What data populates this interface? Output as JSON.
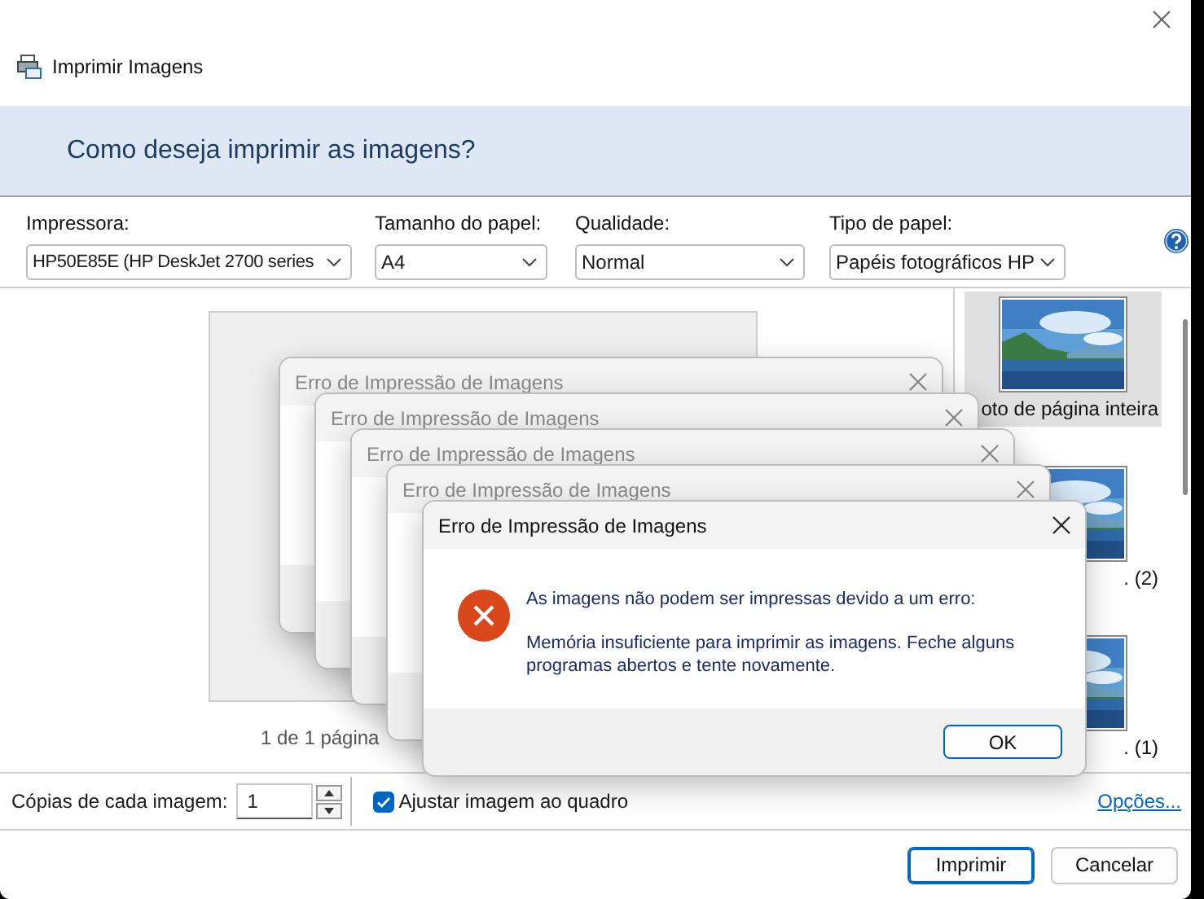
{
  "window": {
    "title": "Imprimir Imagens"
  },
  "heading": "Como deseja imprimir as imagens?",
  "options": [
    {
      "label": "Impressora:",
      "value": "HP50E85E (HP DeskJet 2700 series"
    },
    {
      "label": "Tamanho do papel:",
      "value": "A4"
    },
    {
      "label": "Qualidade:",
      "value": "Normal"
    },
    {
      "label": "Tipo de papel:",
      "value": "Papéis fotográficos HP"
    }
  ],
  "preview": {
    "page_count": "1 de 1 página"
  },
  "layouts": [
    {
      "label": "oto de página inteira",
      "selected": true
    },
    {
      "label": ". (2)",
      "selected": false
    },
    {
      "label": ". (1)",
      "selected": false
    }
  ],
  "copies": {
    "label": "Cópias de cada imagem:",
    "value": "1"
  },
  "fit": {
    "label": "Ajustar imagem ao quadro",
    "checked": true
  },
  "options_link": "Opções...",
  "buttons": [
    {
      "label": "Imprimir",
      "default": true
    },
    {
      "label": "Cancelar",
      "default": false
    }
  ],
  "error_dialogs": [
    {
      "title": "Erro de Impressão de Imagens",
      "active": false
    },
    {
      "title": "Erro de Impressão de Imagens",
      "active": false
    },
    {
      "title": "Erro de Impressão de Imagens",
      "active": false
    },
    {
      "title": "Erro de Impressão de Imagens",
      "active": false
    },
    {
      "title": "Erro de Impressão de Imagens",
      "active": true,
      "message": "As imagens não podem ser impressas devido a um erro:",
      "detail": "Memória insuficiente para imprimir as imagens. Feche alguns programas abertos e tente novamente.",
      "button": "OK"
    }
  ]
}
